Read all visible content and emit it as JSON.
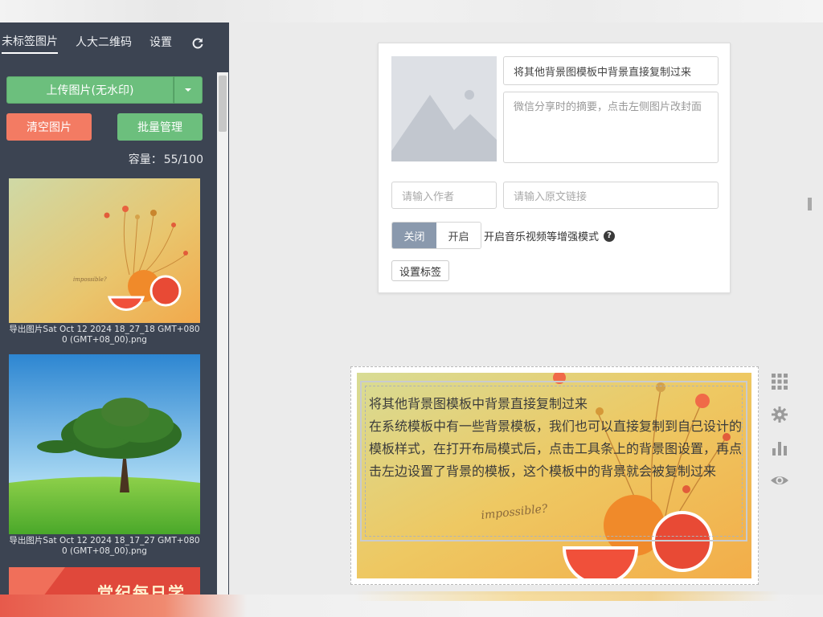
{
  "sidebar": {
    "tabs": [
      {
        "label": "未标签图片",
        "active": true
      },
      {
        "label": "人大二维码",
        "active": false
      },
      {
        "label": "设置",
        "active": false
      }
    ],
    "upload_label": "上传图片(无水印)",
    "clear_label": "清空图片",
    "batch_label": "批量管理",
    "capacity_label": "容量：",
    "capacity_value": "55/100",
    "images": [
      {
        "caption": "导出图片Sat Oct 12 2024 18_27_18 GMT+0800 (GMT+08_00).png"
      },
      {
        "caption": "导出图片Sat Oct 12 2024 18_17_27 GMT+0800 (GMT+08_00).png"
      },
      {
        "text": "党纪每日学"
      }
    ]
  },
  "editor": {
    "title_value": "将其他背景图模板中背景直接复制过来",
    "summary_placeholder": "微信分享时的摘要，点击左侧图片改封面",
    "author_placeholder": "请输入作者",
    "link_placeholder": "请输入原文链接",
    "toggle_off": "关闭",
    "toggle_on": "开启",
    "enhanced_mode_label": "开启音乐视频等增强模式",
    "help_symbol": "?",
    "set_tag_label": "设置标签"
  },
  "preview": {
    "heading": "将其他背景图模板中背景直接复制过来",
    "body": "在系统模板中有一些背景模板，我们也可以直接复制到自己设计的模板样式，在打开布局模式后，点击工具条上的背景图设置，再点击左边设置了背景的模板，这个模板中的背景就会被复制过来",
    "artwork_text": "impossible?"
  },
  "colors": {
    "sidebar_bg": "#3c4452",
    "green": "#6cbf7d",
    "red": "#f37b63",
    "toggle_active": "#8a99ad"
  },
  "icons": [
    "refresh-icon",
    "grid-icon",
    "gear-icon",
    "bar-chart-icon",
    "eye-icon"
  ]
}
